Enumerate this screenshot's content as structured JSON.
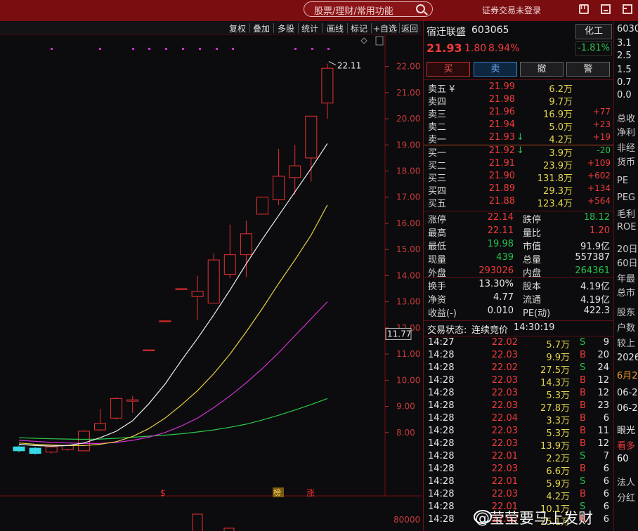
{
  "topbar": {
    "search_placeholder": "股票/理财/常用功能",
    "login_status": "证券交易未登录"
  },
  "chart_toolbar": [
    "复权",
    "叠加",
    "多股",
    "统计",
    "画线",
    "标记",
    "+自选",
    "返回"
  ],
  "chart": {
    "y_ticks": [
      "22.00",
      "21.00",
      "20.00",
      "19.00",
      "18.00",
      "17.00",
      "16.00",
      "15.00",
      "14.00",
      "13.00",
      "12.00",
      "11.00",
      "10.00",
      "9.00",
      "8.00"
    ],
    "current_price_label": "11.77",
    "max_label": "22.11",
    "markers": [
      "$",
      "榜",
      "涨"
    ],
    "volume_tick": "80000"
  },
  "chart_data": {
    "type": "candlestick",
    "ylim": [
      7.0,
      22.5
    ],
    "candles": [
      {
        "o": 7.45,
        "c": 7.3,
        "h": 7.5,
        "l": 7.25
      },
      {
        "o": 7.4,
        "c": 7.2,
        "h": 7.45,
        "l": 7.15
      },
      {
        "o": 7.25,
        "c": 7.45,
        "h": 7.5,
        "l": 7.2
      },
      {
        "o": 7.35,
        "c": 7.5,
        "h": 7.55,
        "l": 7.3
      },
      {
        "o": 7.3,
        "c": 8.05,
        "h": 8.1,
        "l": 7.28
      },
      {
        "o": 8.1,
        "c": 8.35,
        "h": 8.9,
        "l": 8.05
      },
      {
        "o": 8.55,
        "c": 9.3,
        "h": 9.35,
        "l": 8.5
      },
      {
        "o": 9.2,
        "c": 9.25,
        "h": 9.4,
        "l": 8.75
      },
      {
        "o": 11.16,
        "c": 11.16,
        "h": 11.16,
        "l": 11.16
      },
      {
        "o": 12.27,
        "c": 12.27,
        "h": 12.27,
        "l": 12.27
      },
      {
        "o": 13.5,
        "c": 13.5,
        "h": 13.5,
        "l": 13.5
      },
      {
        "o": 13.2,
        "c": 13.4,
        "h": 14.0,
        "l": 12.3
      },
      {
        "o": 12.95,
        "c": 14.6,
        "h": 14.85,
        "l": 12.95
      },
      {
        "o": 14.05,
        "c": 14.8,
        "h": 15.95,
        "l": 13.9
      },
      {
        "o": 14.8,
        "c": 15.6,
        "h": 16.1,
        "l": 13.95
      },
      {
        "o": 16.35,
        "c": 17.0,
        "h": 17.0,
        "l": 16.35
      },
      {
        "o": 16.9,
        "c": 17.8,
        "h": 18.85,
        "l": 16.7
      },
      {
        "o": 17.75,
        "c": 18.2,
        "h": 19.0,
        "l": 17.1
      },
      {
        "o": 18.5,
        "c": 20.1,
        "h": 20.1,
        "l": 17.6
      },
      {
        "o": 20.6,
        "c": 21.93,
        "h": 22.11,
        "l": 20.0
      }
    ],
    "ma_white": [
      7.55,
      7.5,
      7.48,
      7.5,
      7.6,
      7.8,
      8.05,
      8.45,
      9.1,
      9.85,
      10.75,
      11.6,
      12.5,
      13.45,
      14.45,
      15.4,
      16.3,
      17.2,
      18.1,
      19.05
    ],
    "ma_yellow": [
      7.6,
      7.55,
      7.52,
      7.5,
      7.5,
      7.55,
      7.65,
      7.85,
      8.15,
      8.55,
      9.05,
      9.6,
      10.25,
      11.0,
      11.85,
      12.75,
      13.7,
      14.6,
      15.55,
      16.7
    ],
    "ma_magenta": [
      7.7,
      7.66,
      7.62,
      7.6,
      7.58,
      7.58,
      7.62,
      7.7,
      7.82,
      8.0,
      8.25,
      8.55,
      8.95,
      9.4,
      9.9,
      10.45,
      11.05,
      11.7,
      12.35,
      13.0
    ],
    "ma_green": [
      7.8,
      7.78,
      7.76,
      7.75,
      7.74,
      7.75,
      7.78,
      7.82,
      7.86,
      7.9,
      7.95,
      8.02,
      8.1,
      8.2,
      8.32,
      8.48,
      8.66,
      8.86,
      9.07,
      9.3
    ]
  },
  "stock": {
    "name": "宿迁联盛",
    "code": "603065",
    "industry": "化工",
    "industry_change": "-1.81%",
    "price": "21.93",
    "change": "1.80",
    "change_pct": "8.94%"
  },
  "trade_buttons": [
    "买",
    "卖",
    "撤",
    "警"
  ],
  "asks": [
    {
      "label": "卖五 ¥",
      "price": "21.99",
      "vol": "6.2万",
      "delta": ""
    },
    {
      "label": "卖四",
      "price": "21.98",
      "vol": "9.7万",
      "delta": ""
    },
    {
      "label": "卖三",
      "price": "21.96",
      "vol": "16.9万",
      "delta": "+77"
    },
    {
      "label": "卖二",
      "price": "21.94",
      "vol": "5.0万",
      "delta": "+23"
    },
    {
      "label": "卖一",
      "price": "21.93",
      "arrow": "↓",
      "vol": "4.2万",
      "delta": "+19"
    }
  ],
  "bids": [
    {
      "label": "买一",
      "price": "21.92",
      "arrow": "↓",
      "vol": "3.9万",
      "delta": "-20"
    },
    {
      "label": "买二",
      "price": "21.91",
      "vol": "23.9万",
      "delta": "+109"
    },
    {
      "label": "买三",
      "price": "21.90",
      "vol": "131.8万",
      "delta": "+602"
    },
    {
      "label": "买四",
      "price": "21.89",
      "vol": "29.3万",
      "delta": "+134"
    },
    {
      "label": "买五",
      "price": "21.88",
      "vol": "123.4万",
      "delta": "+564"
    }
  ],
  "stats": [
    {
      "l1": "涨停",
      "v1": "22.14",
      "c1": "red",
      "l2": "跌停",
      "v2": "18.12",
      "c2": "green"
    },
    {
      "l1": "最高",
      "v1": "22.11",
      "c1": "red",
      "l2": "量比",
      "v2": "1.20",
      "c2": "red"
    },
    {
      "l1": "最低",
      "v1": "19.98",
      "c1": "green",
      "l2": "市值",
      "v2": "91.9亿",
      "c2": "white"
    },
    {
      "l1": "现量",
      "v1": "439",
      "c1": "green",
      "l2": "总量",
      "v2": "557387",
      "c2": "white"
    },
    {
      "l1": "外盘",
      "v1": "293026",
      "c1": "red",
      "l2": "内盘",
      "v2": "264361",
      "c2": "green"
    }
  ],
  "stats2": [
    {
      "l1": "换手",
      "v1": "13.30%",
      "l2": "股本",
      "v2": "4.19亿"
    },
    {
      "l1": "净资",
      "v1": "4.77",
      "l2": "流通",
      "v2": "4.19亿"
    },
    {
      "l1": "收益(-)",
      "v1": "0.010",
      "l2": "PE(动)",
      "v2": "422.3"
    }
  ],
  "trade_status": {
    "label": "交易状态:",
    "value": "连续竞价",
    "time": "14:30:19"
  },
  "ticks": [
    {
      "t": "14:27",
      "p": "22.02",
      "v": "5.7万",
      "s": "S",
      "n": "9"
    },
    {
      "t": "14:28",
      "p": "22.03",
      "v": "9.9万",
      "s": "B",
      "n": "20"
    },
    {
      "t": "14:28",
      "p": "22.02",
      "v": "27.5万",
      "s": "S",
      "n": "24"
    },
    {
      "t": "14:28",
      "p": "22.03",
      "v": "14.3万",
      "s": "B",
      "n": "12"
    },
    {
      "t": "14:28",
      "p": "22.03",
      "v": "5.3万",
      "s": "B",
      "n": "12"
    },
    {
      "t": "14:28",
      "p": "22.03",
      "v": "27.8万",
      "s": "B",
      "n": "23"
    },
    {
      "t": "14:28",
      "p": "22.04",
      "v": "3.3万",
      "s": "B",
      "n": "6"
    },
    {
      "t": "14:28",
      "p": "22.03",
      "v": "5.3万",
      "s": "B",
      "n": "11"
    },
    {
      "t": "14:28",
      "p": "22.03",
      "v": "13.9万",
      "s": "B",
      "n": "12"
    },
    {
      "t": "14:28",
      "p": "22.01",
      "v": "2.2万",
      "s": "S",
      "n": "7"
    },
    {
      "t": "14:28",
      "p": "22.03",
      "v": "6.6万",
      "s": "B",
      "n": "6"
    },
    {
      "t": "14:28",
      "p": "22.01",
      "v": "5.9万",
      "s": "S",
      "n": "6"
    },
    {
      "t": "14:28",
      "p": "22.03",
      "v": "4.2万",
      "s": "B",
      "n": "6"
    },
    {
      "t": "14:28",
      "p": "22.01",
      "v": "10.1万",
      "s": "S",
      "n": "6"
    },
    {
      "t": "14:28",
      "p": "22.03",
      "v": "25.1万",
      "s": "B",
      "n": "6"
    }
  ],
  "cut_column": [
    {
      "text": "6030",
      "color": "#e6e6e6"
    },
    {
      "text": "3.1",
      "color": "#e6e6e6"
    },
    {
      "text": "2.5",
      "color": "#e6e6e6"
    },
    {
      "text": "1.5",
      "color": "#e6e6e6"
    },
    {
      "text": "0.7",
      "color": "#e6e6e6"
    },
    {
      "text": "0.0",
      "color": "#e6e6e6"
    },
    {
      "text": "总收",
      "color": "#c8c8c8"
    },
    {
      "text": "净利",
      "color": "#c8c8c8"
    },
    {
      "text": "非经",
      "color": "#c8c8c8"
    },
    {
      "text": "货币",
      "color": "#c8c8c8"
    },
    {
      "text": "PE",
      "color": "#c8c8c8"
    },
    {
      "text": "PEG",
      "color": "#c8c8c8"
    },
    {
      "text": "毛利",
      "color": "#c8c8c8"
    },
    {
      "text": "ROE",
      "color": "#c8c8c8"
    },
    {
      "text": "20日",
      "color": "#c8c8c8"
    },
    {
      "text": "60日",
      "color": "#c8c8c8"
    },
    {
      "text": "年最",
      "color": "#c8c8c8"
    },
    {
      "text": "总市",
      "color": "#c8c8c8"
    },
    {
      "text": "股东",
      "color": "#c8c8c8"
    },
    {
      "text": "户数",
      "color": "#c8c8c8"
    },
    {
      "text": "较上",
      "color": "#c8c8c8"
    },
    {
      "text": "2026",
      "color": "#e6e6e6"
    },
    {
      "text": "6月2",
      "color": "#f09a2a"
    },
    {
      "text": "06-2",
      "color": "#e6e6e6"
    },
    {
      "text": "06-2",
      "color": "#e6e6e6"
    },
    {
      "text": "眼光",
      "color": "#e6e6e6"
    },
    {
      "text": "看多",
      "color": "#f03a3a"
    },
    {
      "text": "60",
      "color": "#ffffff"
    },
    {
      "text": "法人",
      "color": "#c8c8c8"
    },
    {
      "text": "分红",
      "color": "#c8c8c8"
    }
  ],
  "watermark": "@莹莹要马上发财"
}
